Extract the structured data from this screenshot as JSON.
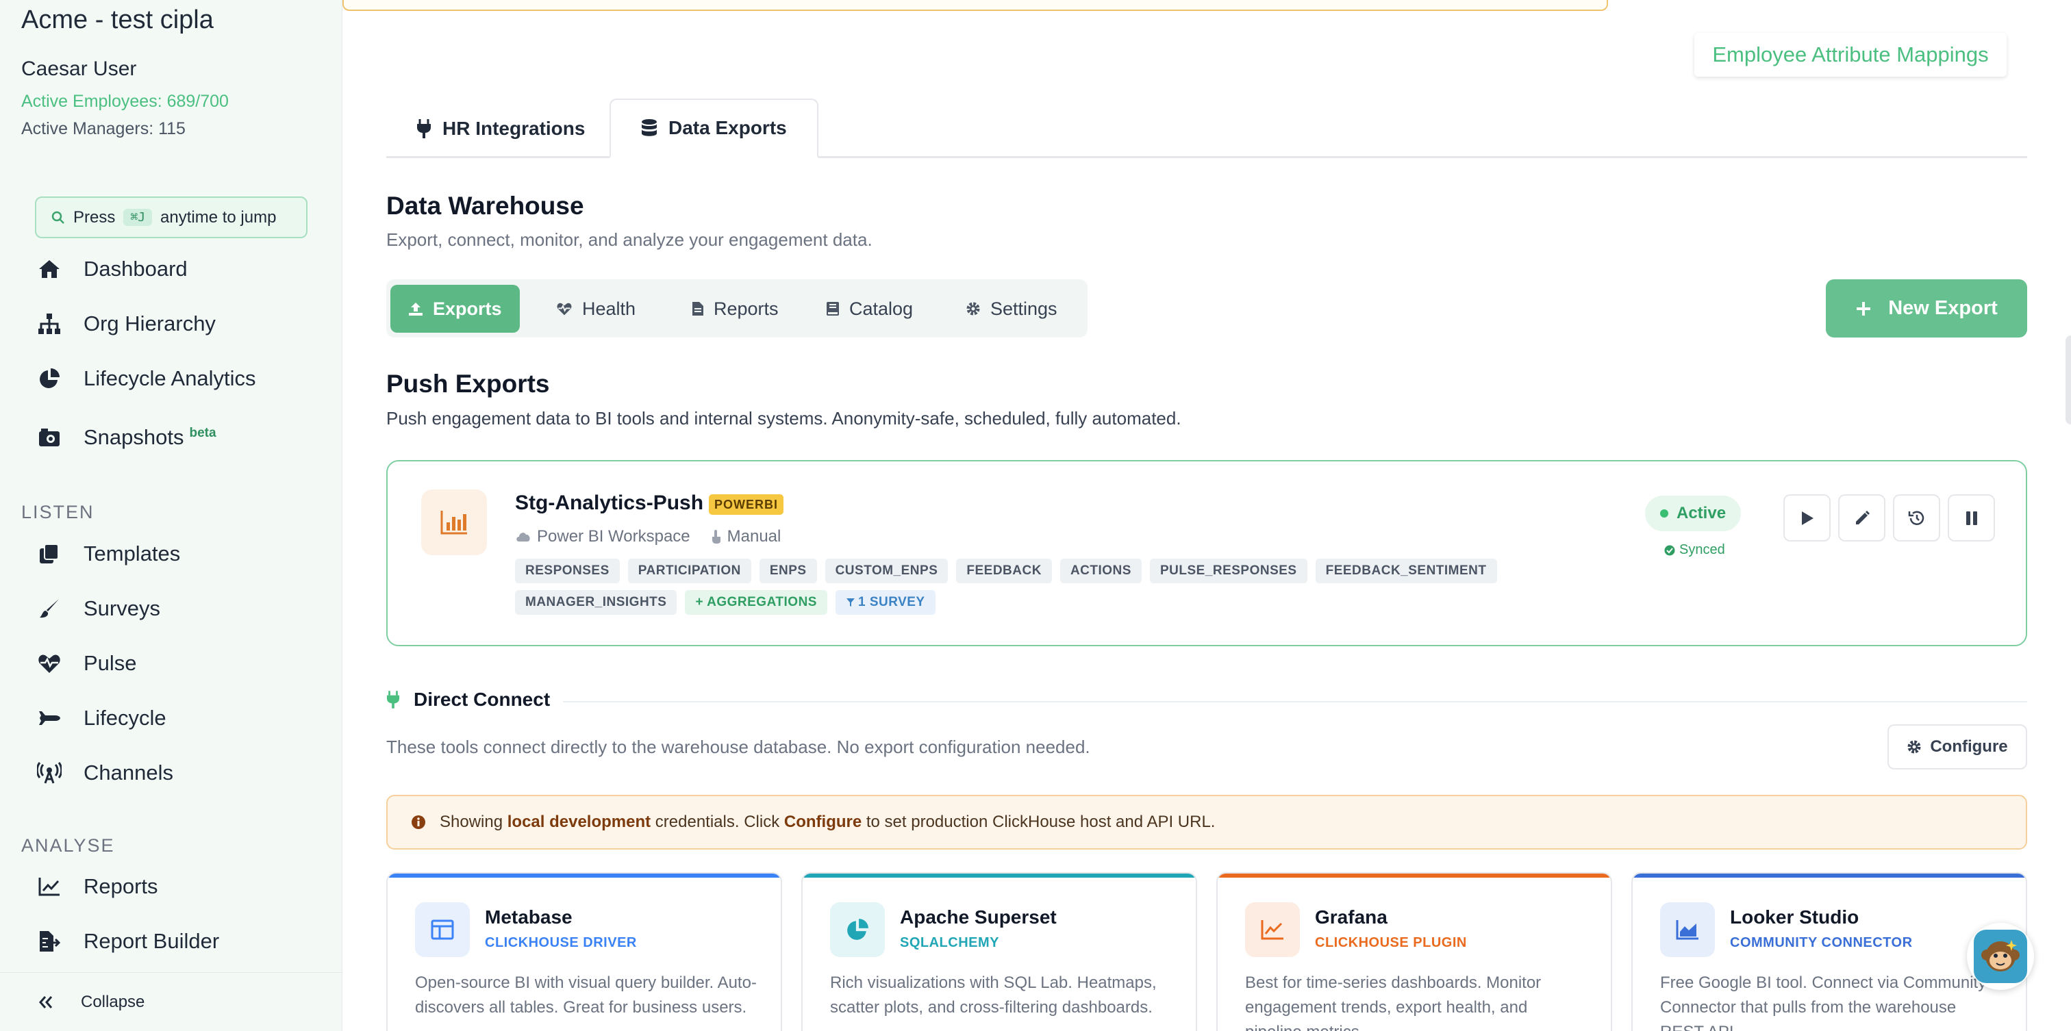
{
  "sidebar": {
    "org_name": "Acme - test cipla",
    "user_name": "Caesar User",
    "active_employees": "Active Employees: 689/700",
    "active_managers": "Active Managers: 115",
    "jump": {
      "prefix": "Press",
      "shortcut": "⌘J",
      "suffix": "anytime to jump"
    },
    "nav": [
      {
        "label": "Dashboard",
        "icon": "home-icon"
      },
      {
        "label": "Org Hierarchy",
        "icon": "sitemap-icon"
      },
      {
        "label": "Lifecycle Analytics",
        "icon": "pie-chart-icon"
      },
      {
        "label": "Snapshots",
        "icon": "camera-icon",
        "badge": "beta"
      }
    ],
    "listen_label": "LISTEN",
    "listen": [
      {
        "label": "Templates",
        "icon": "clone-icon"
      },
      {
        "label": "Surveys",
        "icon": "brush-icon"
      },
      {
        "label": "Pulse",
        "icon": "heartbeat-icon"
      },
      {
        "label": "Lifecycle",
        "icon": "plane-icon"
      },
      {
        "label": "Channels",
        "icon": "broadcast-icon"
      }
    ],
    "analyse_label": "ANALYSE",
    "analyse": [
      {
        "label": "Reports",
        "icon": "line-chart-icon"
      },
      {
        "label": "Report Builder",
        "icon": "file-export-icon"
      }
    ],
    "collapse_label": "Collapse"
  },
  "header": {
    "attribute_mappings": "Employee Attribute Mappings"
  },
  "tabs": [
    {
      "label": "HR Integrations",
      "icon": "plug-icon"
    },
    {
      "label": "Data Exports",
      "icon": "database-icon"
    }
  ],
  "warehouse": {
    "title": "Data Warehouse",
    "subtitle": "Export, connect, monitor, and analyze your engagement data.",
    "subnav": [
      {
        "label": "Exports",
        "icon": "upload-icon"
      },
      {
        "label": "Health",
        "icon": "heartbeat-icon"
      },
      {
        "label": "Reports",
        "icon": "file-icon"
      },
      {
        "label": "Catalog",
        "icon": "book-icon"
      },
      {
        "label": "Settings",
        "icon": "gear-icon"
      }
    ],
    "new_export": "New Export"
  },
  "push": {
    "title": "Push Exports",
    "subtitle": "Push engagement data to BI tools and internal systems. Anonymity-safe, scheduled, fully automated.",
    "export": {
      "name": "Stg-Analytics-Push",
      "badge": "POWERBI",
      "destination": "Power BI Workspace",
      "schedule": "Manual",
      "tags": [
        "RESPONSES",
        "PARTICIPATION",
        "ENPS",
        "CUSTOM_ENPS",
        "FEEDBACK",
        "ACTIONS",
        "PULSE_RESPONSES",
        "FEEDBACK_SENTIMENT",
        "MANAGER_INSIGHTS"
      ],
      "aggregations": "+ AGGREGATIONS",
      "filter": "1 SURVEY",
      "status": "Active",
      "sync": "Synced"
    }
  },
  "direct": {
    "title": "Direct Connect",
    "subtitle": "These tools connect directly to the warehouse database. No export configuration needed.",
    "configure": "Configure",
    "notice": {
      "p1": "Showing",
      "b1": "local development",
      "p2": "credentials. Click",
      "b2": "Configure",
      "p3": "to set production ClickHouse host and API URL."
    },
    "tools": [
      {
        "name": "Metabase",
        "sub": "CLICKHOUSE DRIVER",
        "desc": "Open-source BI with visual query builder. Auto-discovers all tables. Great for business users.",
        "color": "#3b82f6",
        "icon": "table-layout-icon"
      },
      {
        "name": "Apache Superset",
        "sub": "SQLALCHEMY",
        "desc": "Rich visualizations with SQL Lab. Heatmaps, scatter plots, and cross-filtering dashboards.",
        "color": "#21a6b6",
        "icon": "pie-chart-icon"
      },
      {
        "name": "Grafana",
        "sub": "CLICKHOUSE PLUGIN",
        "desc": "Best for time-series dashboards. Monitor engagement trends, export health, and pipeline metrics.",
        "color": "#ea6a1f",
        "icon": "trend-chart-icon"
      },
      {
        "name": "Looker Studio",
        "sub": "COMMUNITY CONNECTOR",
        "desc": "Free Google BI tool. Connect via Community Connector that pulls from the warehouse REST API.",
        "color": "#3b6fd8",
        "icon": "area-chart-icon"
      }
    ]
  },
  "colors": {
    "brand_green": "#5cb985",
    "accent_green_text": "#4bbf80",
    "powerbi_badge": "#f6c842",
    "notice_bg": "#fef5ea"
  }
}
